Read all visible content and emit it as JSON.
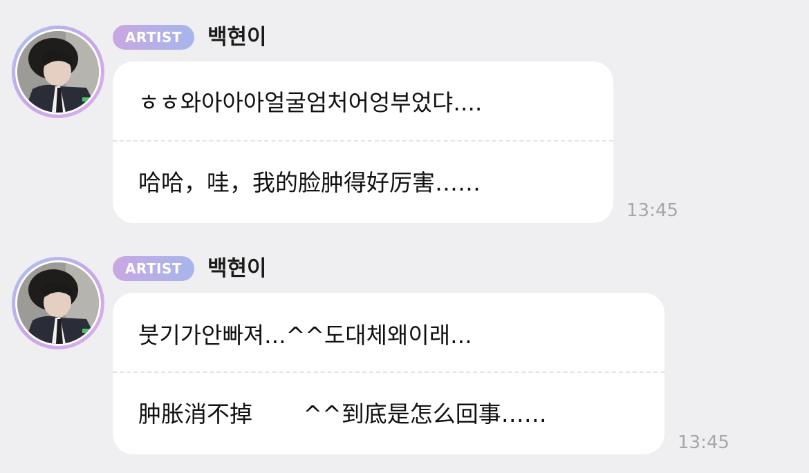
{
  "messages": [
    {
      "badge": "ARTIST",
      "sender": "백현이",
      "original": "ㅎㅎ와아아아얼굴엄처어엉부었댜....",
      "translation": "哈哈，哇，我的脸肿得好厉害……",
      "time": "13:45"
    },
    {
      "badge": "ARTIST",
      "sender": "백현이",
      "original": "붓기가안빠져...^^도대체왜이래...",
      "translation": "肿胀消不掉       ^^到底是怎么回事……",
      "time": "13:45"
    }
  ],
  "colors": {
    "background": "#efeff1",
    "bubble": "#ffffff",
    "badge_gradient_start": "#c9a7e3",
    "badge_gradient_end": "#a6b6ec",
    "avatar_ring_start": "#a9c4f1",
    "avatar_ring_end": "#dcb0ea",
    "time_text": "#a6a6a6"
  }
}
